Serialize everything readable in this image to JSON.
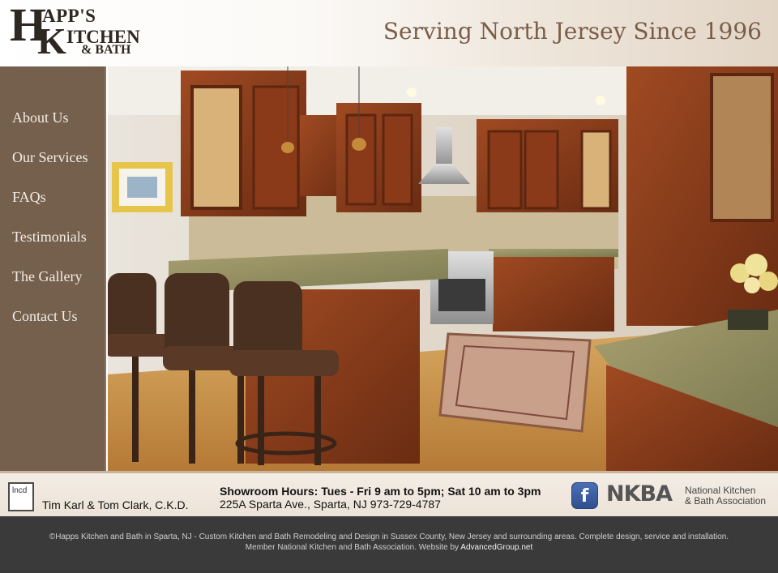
{
  "header": {
    "logo": {
      "letter_h": "H",
      "happs": "APP'S",
      "letter_k": "K",
      "itchen": "ITCHEN",
      "bath": "& BATH"
    },
    "tagline": "Serving North Jersey Since 1996"
  },
  "nav": {
    "items": [
      {
        "label": "About Us"
      },
      {
        "label": "Our Services"
      },
      {
        "label": "FAQs"
      },
      {
        "label": "Testimonials"
      },
      {
        "label": "The Gallery"
      },
      {
        "label": "Contact Us"
      }
    ]
  },
  "hero": {
    "image_subject": "kitchen-photo"
  },
  "info": {
    "monogram": "lncd",
    "owners": "Tim Karl & Tom Clark, C.K.D.",
    "hours": "Showroom Hours: Tues - Fri 9 am to 5pm; Sat 10 am to 3pm",
    "address": "225A Sparta Ave., Sparta, NJ 973-729-4787",
    "facebook_icon": "facebook-icon",
    "facebook_glyph": "f",
    "nkba_logo": "NKBA",
    "nkba_line1": "National Kitchen",
    "nkba_line2": "& Bath Association"
  },
  "footer": {
    "line1": "©Happs Kitchen and Bath in Sparta, NJ - Custom Kitchen and Bath Remodeling and Design in Sussex County, New Jersey and surrounding areas. Complete design, service and installation.",
    "line2_prefix": "Member National Kitchen and Bath Association. Website by ",
    "link": "AdvancedGroup.net"
  },
  "colors": {
    "sidebar": "#75604d",
    "tagline": "#7a5e48",
    "footer": "#3a3a3a",
    "cabinet": "#8a3f1e"
  }
}
